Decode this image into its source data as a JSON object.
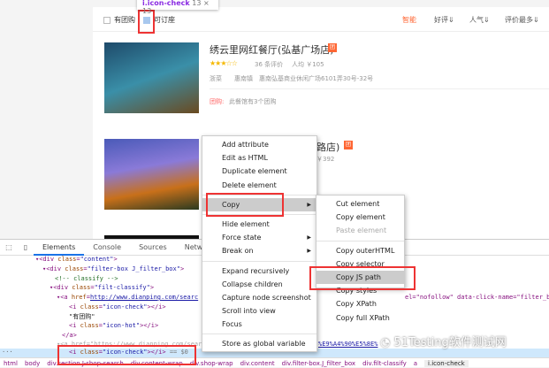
{
  "tooltip": {
    "selector": "i.icon-check",
    "size": "13 × 13"
  },
  "filters": {
    "group_buy": "有团购",
    "reservable": "可订座"
  },
  "sorts": [
    {
      "label": "智能",
      "active": true
    },
    {
      "label": "好评"
    },
    {
      "label": "人气"
    },
    {
      "label": "评价最多"
    }
  ],
  "shops": [
    {
      "name": "绣云里网红餐厅(弘基广场店)",
      "badge": "团",
      "stars": 3,
      "reviews": "36 条评价",
      "avg": "人均 ￥105",
      "cuisine": "浙菜",
      "area": "惠南镇",
      "address": "惠南弘基商业休闲广场6101弄30号-32号",
      "deal_label": "团购:",
      "deal": "此餐馆有3个团购"
    },
    {
      "name_tail": "路店)",
      "badge": "团",
      "avg": "￥392"
    }
  ],
  "context_menu": [
    "Add attribute",
    "Edit as HTML",
    "Duplicate element",
    "Delete element",
    "Copy",
    "Hide element",
    "Force state",
    "Break on",
    "Expand recursively",
    "Collapse children",
    "Capture node screenshot",
    "Scroll into view",
    "Focus",
    "Store as global variable"
  ],
  "copy_submenu": [
    "Cut element",
    "Copy element",
    "Paste element",
    "Copy outerHTML",
    "Copy selector",
    "Copy JS path",
    "Copy styles",
    "Copy XPath",
    "Copy full XPath"
  ],
  "devtools": {
    "tabs": [
      "Elements",
      "Console",
      "Sources",
      "Network",
      "Pe"
    ],
    "breadcrumbs": [
      "html",
      "body",
      "div.section.J-shop-search",
      "div.content-wrap",
      "div.shop-wrap",
      "div.content",
      "div.filter-box.J_filter_box",
      "div.filt-classify",
      "a",
      "i.icon-check"
    ],
    "extra_attrs": "el=\"nofollow\" data-click-name=\"filter_b",
    "extra_attrs2": "%E9%A4%90%E5%8E%",
    "text_node": "\"有团购\"",
    "selected_suffix": "== $0",
    "url": "http://www.dianping.com/searc"
  },
  "watermark": "51Testing软件测试网",
  "colors": {
    "accent": "#ff6633",
    "highlight": "#e33333",
    "selected_row": "#cfe8fc"
  }
}
